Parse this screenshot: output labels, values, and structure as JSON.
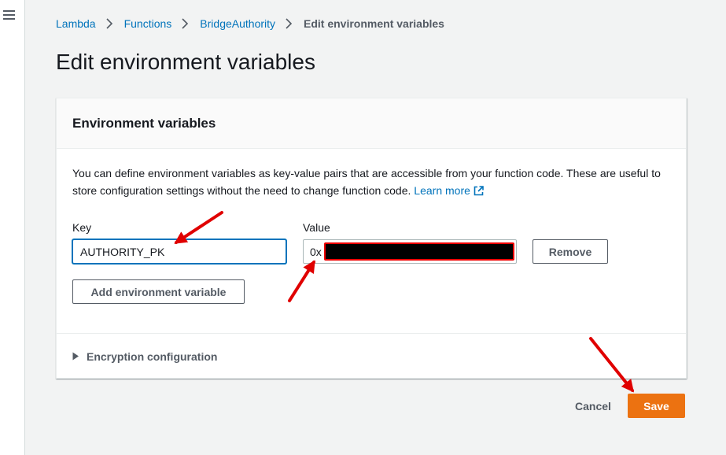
{
  "nav": {
    "menu_icon": "hamburger-menu-icon"
  },
  "breadcrumb": {
    "items": [
      "Lambda",
      "Functions",
      "BridgeAuthority"
    ],
    "current": "Edit environment variables",
    "separator_icon": "chevron-right-icon"
  },
  "page": {
    "title": "Edit environment variables"
  },
  "panel": {
    "title": "Environment variables",
    "description": "You can define environment variables as key-value pairs that are accessible from your function code. These are useful to store configuration settings without the need to change function code.",
    "learn_more": "Learn more",
    "learn_more_icon": "external-link-icon",
    "key_label": "Key",
    "value_label": "Value",
    "key_value": "AUTHORITY_PK",
    "value_prefix": "0x",
    "remove_label": "Remove",
    "add_label": "Add environment variable",
    "encryption_label": "Encryption configuration",
    "encryption_icon": "caret-right-icon"
  },
  "actions": {
    "cancel_label": "Cancel",
    "save_label": "Save"
  },
  "colors": {
    "link": "#0073bb",
    "primary": "#ec7211",
    "annotation_arrow": "#e00000",
    "background": "#f2f3f3"
  }
}
